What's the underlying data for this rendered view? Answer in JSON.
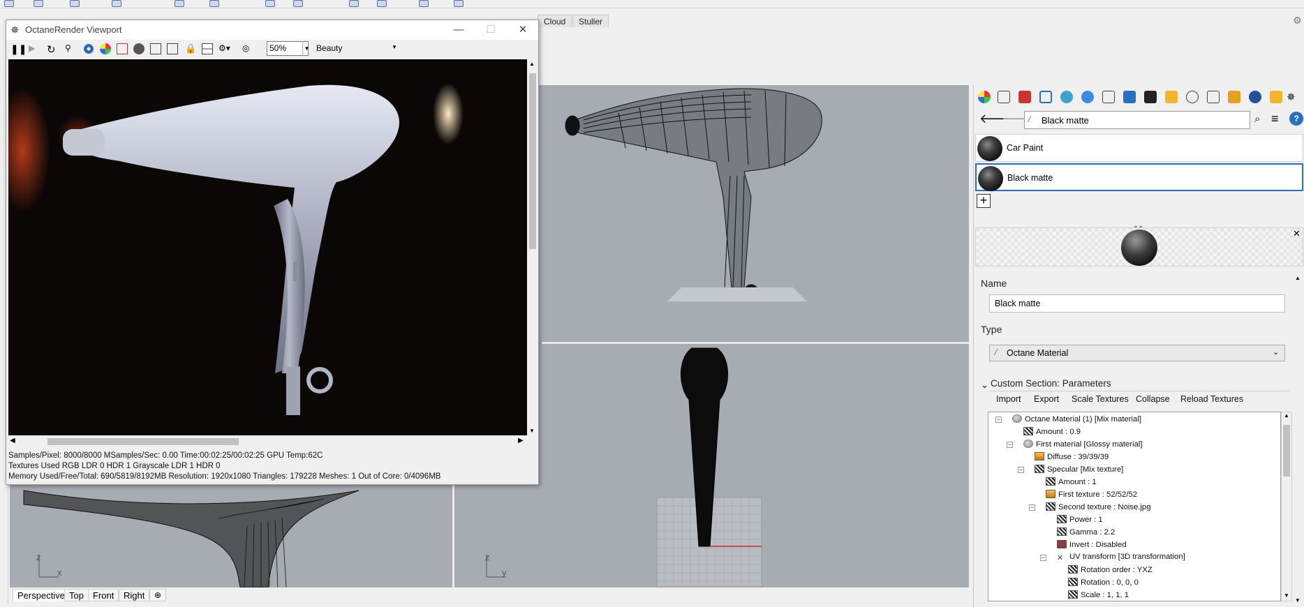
{
  "top_tabs": [
    "Cloud",
    "Stuller"
  ],
  "octane_window": {
    "title": "OctaneRender Viewport",
    "zoom": "50%",
    "render_pass": "Beauty",
    "status": {
      "line1": "Samples/Pixel: 8000/8000  MSamples/Sec: 0.00  Time:00:02:25/00:02:25  GPU Temp:62C",
      "line2": "Textures Used RGB LDR 0  HDR 1  Grayscale LDR 1  HDR 0",
      "line3": "Memory Used/Free/Total: 690/5819/8192MB  Resolution: 1920x1080  Triangles: 179228  Meshes: 1 Out of Core: 0/4096MB"
    }
  },
  "viewports": {
    "axis_perspective_z": "z",
    "axis_perspective_x": "x",
    "axis_right_z": "z",
    "axis_right_y": "y"
  },
  "bottom_tabs": [
    "Perspective",
    "Top",
    "Front",
    "Right"
  ],
  "materials_panel": {
    "search_value": "Black matte",
    "materials": [
      "Car Paint",
      "Black matte"
    ],
    "name_label": "Name",
    "name_value": "Black matte",
    "type_label": "Type",
    "type_value": "Octane Material",
    "section_title": "Custom Section: Parameters",
    "actions": [
      "Import",
      "Export",
      "Scale Textures",
      "Collapse",
      "Reload Textures"
    ],
    "tree": [
      {
        "text": "Octane Material (1)  [Mix material]",
        "level": 0,
        "icon": "ball",
        "toggle": true
      },
      {
        "text": "Amount : 0.9",
        "level": 1,
        "icon": "dark"
      },
      {
        "text": "First material  [Glossy material]",
        "level": 1,
        "icon": "ball",
        "toggle": true
      },
      {
        "text": "Diffuse : 39/39/39",
        "level": 2,
        "icon": "tex"
      },
      {
        "text": "Specular  [Mix texture]",
        "level": 2,
        "icon": "dark",
        "toggle": true
      },
      {
        "text": "Amount : 1",
        "level": 3,
        "icon": "dark"
      },
      {
        "text": "First texture : 52/52/52",
        "level": 3,
        "icon": "tex"
      },
      {
        "text": "Second texture : Noise.jpg",
        "level": 3,
        "icon": "dark",
        "toggle": true
      },
      {
        "text": "Power : 1",
        "level": 4,
        "icon": "dark"
      },
      {
        "text": "Gamma : 2.2",
        "level": 4,
        "icon": "dark"
      },
      {
        "text": "Invert : Disabled",
        "level": 4,
        "icon": "invert"
      },
      {
        "text": "UV transform  [3D transformation]",
        "level": 4,
        "icon": "uv",
        "toggle": true
      },
      {
        "text": "Rotation order : YXZ",
        "level": 5,
        "icon": "dark"
      },
      {
        "text": "Rotation : 0, 0, 0",
        "level": 5,
        "icon": "dark"
      },
      {
        "text": "Scale : 1, 1, 1",
        "level": 5,
        "icon": "dark"
      }
    ]
  },
  "colors": {
    "viewport_bg": "#a7abb2",
    "selection_blue": "#2770c4",
    "render_bg": "#0a0706"
  }
}
